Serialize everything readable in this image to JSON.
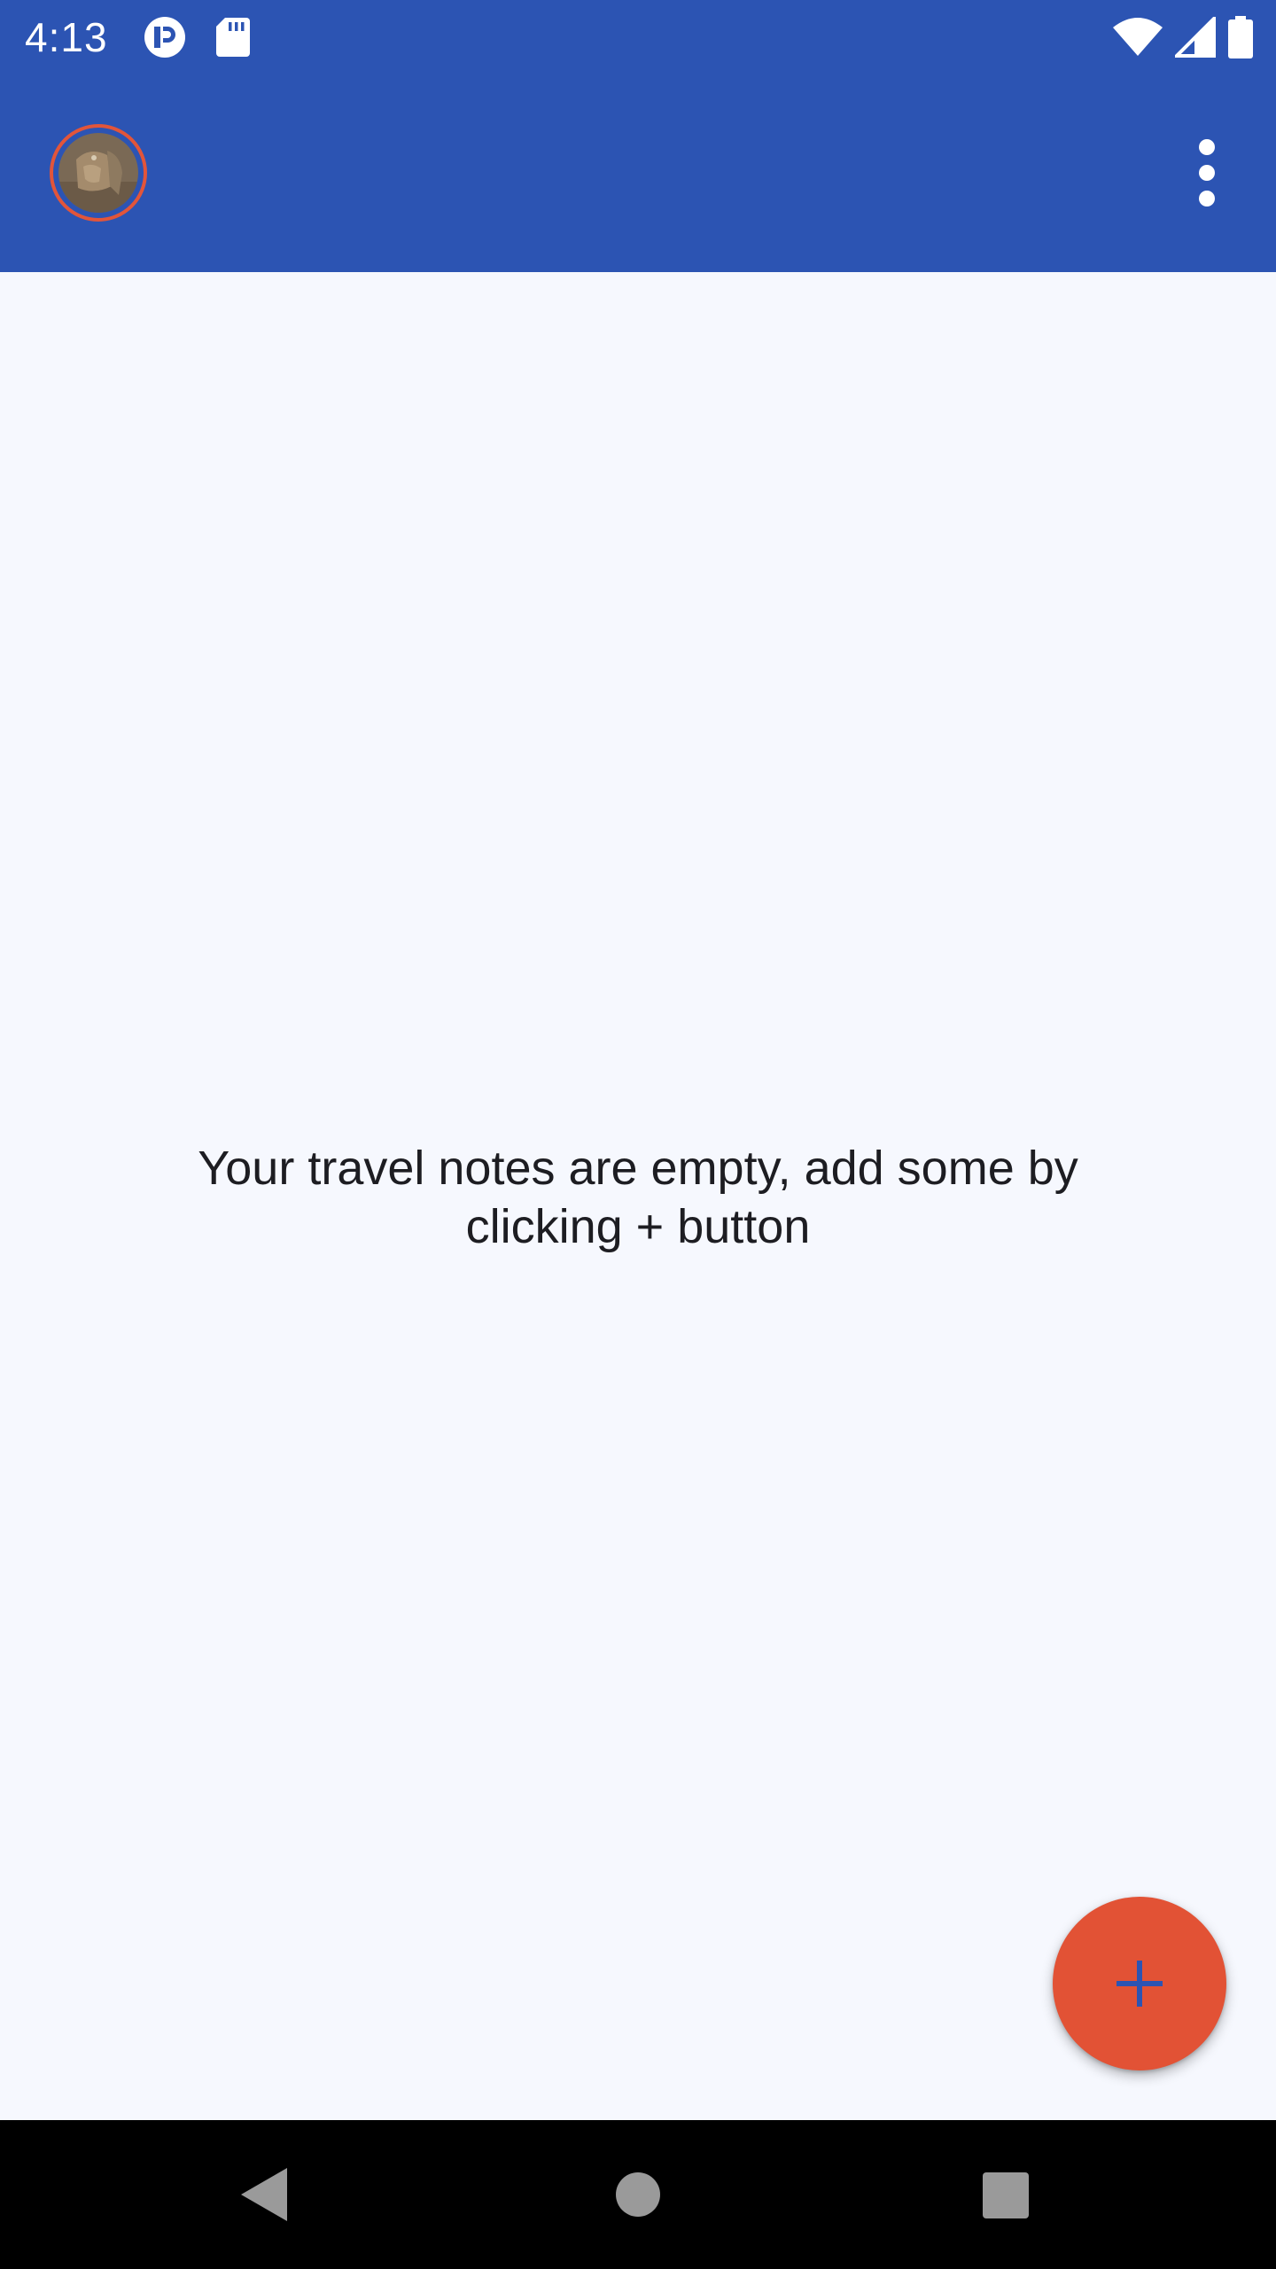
{
  "status_bar": {
    "time": "4:13",
    "icons": [
      "notification-app-icon",
      "sd-card-icon",
      "wifi-icon",
      "signal-icon",
      "battery-icon"
    ]
  },
  "app_bar": {
    "avatar": "profile-avatar",
    "menu_icon": "more-vert-icon"
  },
  "main": {
    "empty_message": "Your travel notes are empty, add some by clicking + button"
  },
  "fab": {
    "icon": "plus-icon"
  },
  "nav_bar": {
    "icons": [
      "back-icon",
      "home-icon",
      "recents-icon"
    ]
  },
  "colors": {
    "primary": "#2C54B3",
    "accent": "#E25235",
    "background": "#F6F8FE",
    "text": "#1D1D22"
  }
}
